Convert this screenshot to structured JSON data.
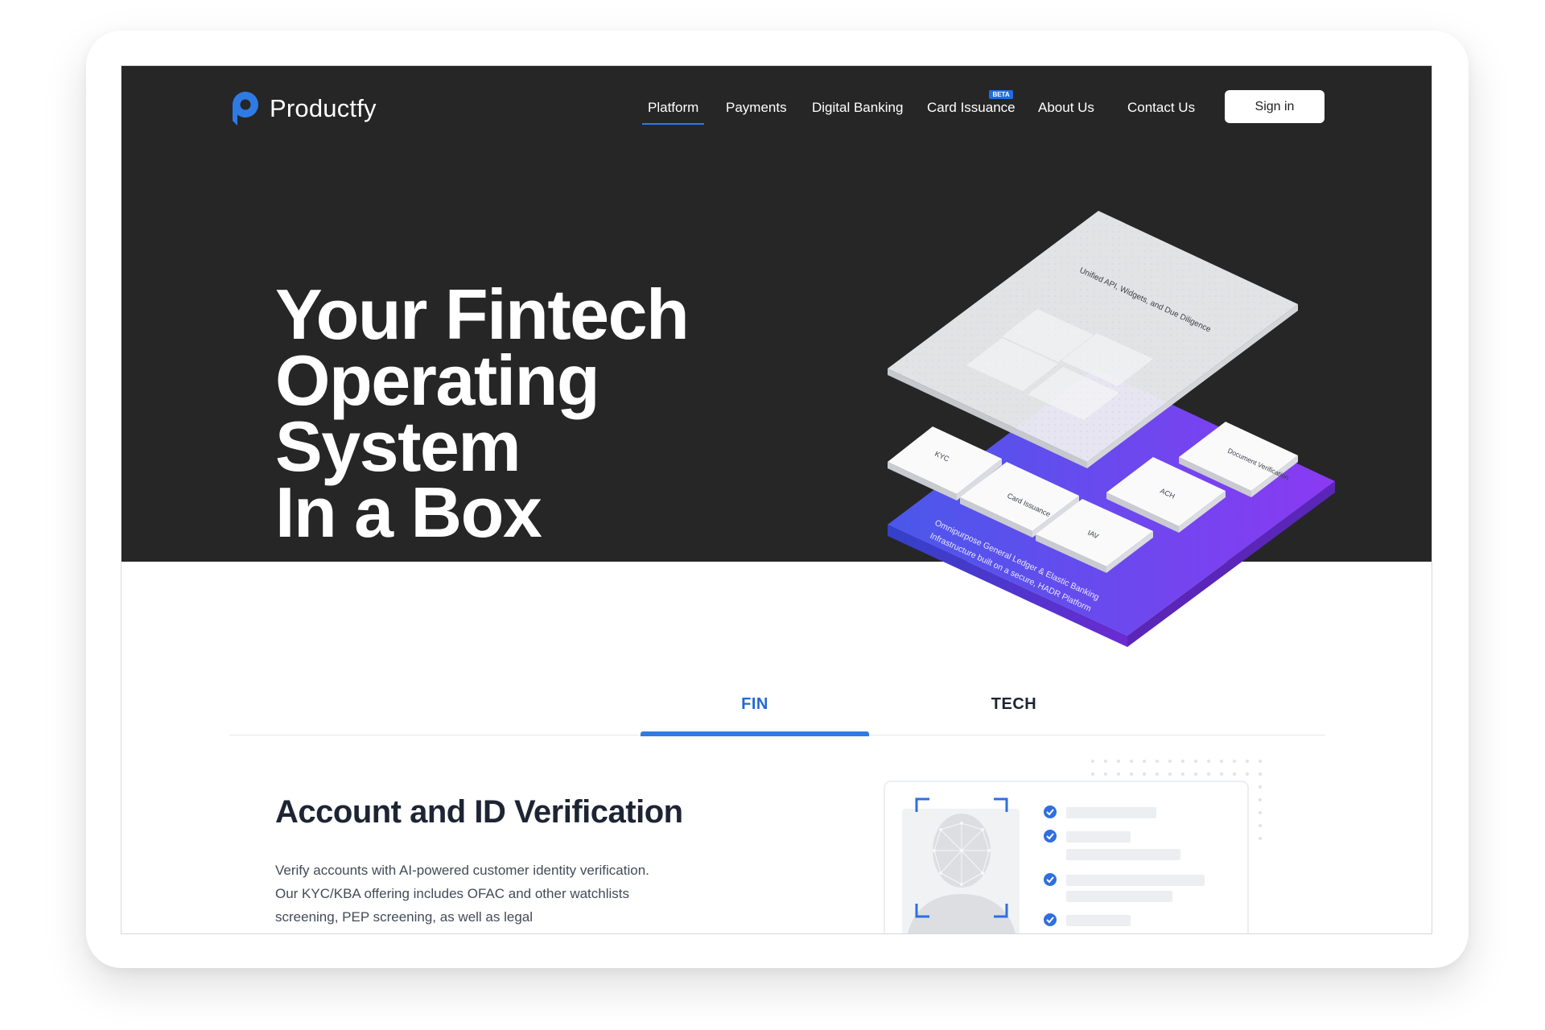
{
  "brand": {
    "name": "Productfy",
    "accent_color": "#2f7ae5"
  },
  "nav": {
    "items": [
      {
        "label": "Platform",
        "active": true
      },
      {
        "label": "Payments"
      },
      {
        "label": "Digital Banking"
      },
      {
        "label": "Card Issuance",
        "badge": "BETA"
      },
      {
        "label": "About Us"
      },
      {
        "label": "Contact Us"
      }
    ],
    "signin_label": "Sign in"
  },
  "hero": {
    "title_lines": [
      "Your Fintech",
      "Operating System",
      "In a Box"
    ],
    "stack": {
      "top_layer_label": "Unified API, Widgets, and Due Diligence",
      "modules": [
        "KYC",
        "Card Issuance",
        "ACH",
        "IAV",
        "Document Verification"
      ],
      "base_label_line1": "Omnipurpose General Ledger & Elastic Banking",
      "base_label_line2": "Infrastructure built on a secure, HADR Platform"
    }
  },
  "tabs": {
    "items": [
      "FIN",
      "TECH"
    ],
    "active": "FIN"
  },
  "feature": {
    "title": "Account and ID Verification",
    "description": "Verify accounts with AI-powered customer identity verification. Our KYC/KBA offering includes OFAC and other watchlists screening, PEP screening, as well as legal"
  }
}
